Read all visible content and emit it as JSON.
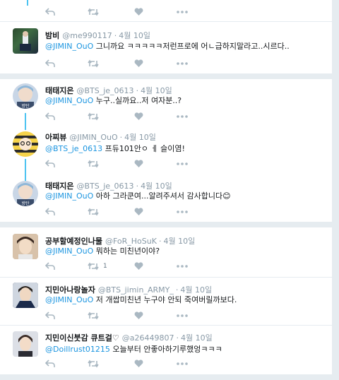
{
  "tweets": [
    {
      "name": "",
      "handle": "",
      "time": "",
      "mention": "",
      "text": "",
      "count": ""
    },
    {
      "name": "밤비",
      "handle": "@me990117",
      "time": "4월 10일",
      "mention": "@JIMIN_OuO",
      "text": " 그니까요 ㅋㅋㅋㅋㅋ저런프로에 어ㄴ급하지말라고..시르다..",
      "count": ""
    },
    {
      "name": "태태지은",
      "handle": "@BTS_je_0613",
      "time": "4월 10일",
      "mention": "@JIMIN_OuO",
      "text": " 누구..실까요..저 여자분..?",
      "count": ""
    },
    {
      "name": "아찌뷰",
      "handle": "@JIMIN_OuO",
      "time": "4월 10일",
      "mention": "@BTS_je_0613",
      "text": " 프듀101안ㅇ ㅔ 슬이염!",
      "count": ""
    },
    {
      "name": "태태지은",
      "handle": "@BTS_je_0613",
      "time": "4월 10일",
      "mention": "@JIMIN_OuO",
      "text": " 아하 그라쿤여...알려주셔서 감사합니다😊",
      "count": ""
    },
    {
      "name": "공부할예정인나물",
      "handle": "@FoR_HoSuK",
      "time": "4월 10일",
      "mention": "@JIMIN_OuO",
      "text": " 뭐하는 미친년이야?",
      "count": "1"
    },
    {
      "name": "지민아나랑놀자",
      "handle": "@BTS_jimin_ARMY_",
      "time": "4월 10일",
      "mention": "@JIMIN_OuO",
      "text": " 저 개쌉미친년 누구야 안되 죽여버릴까보다.",
      "count": ""
    },
    {
      "name": "지민이신붓감 큐트걸♡",
      "handle": "@a26449807",
      "time": "4월 10일",
      "mention": "@Doillrust01215",
      "text": " 오늘부터 안좋아하기루했엉ㅋㅋㅋ",
      "count": ""
    }
  ],
  "icons": {
    "reply": "reply-icon",
    "retweet": "retweet-icon",
    "like": "heart-icon",
    "more": "more-icon"
  },
  "colors": {
    "link": "#1b95e0",
    "thread": "#4cc3f1",
    "icon": "#aab8c2",
    "background": "#e6ecf0"
  }
}
